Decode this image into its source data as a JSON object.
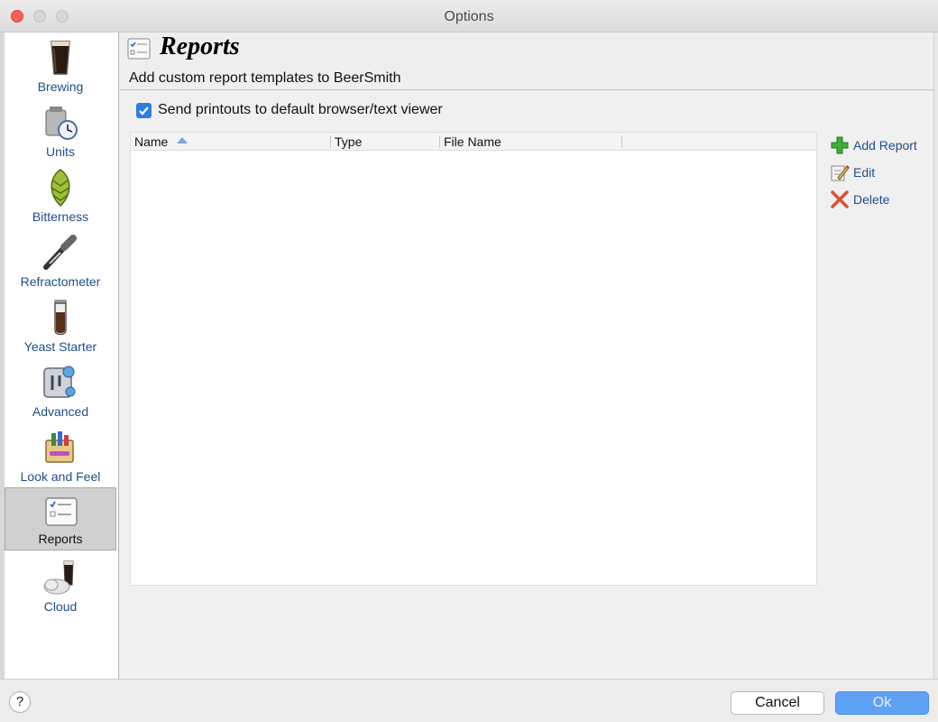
{
  "window": {
    "title": "Options"
  },
  "sidebar": {
    "items": [
      {
        "label": "Brewing",
        "icon": "beer-glass-icon"
      },
      {
        "label": "Units",
        "icon": "units-clock-icon"
      },
      {
        "label": "Bitterness",
        "icon": "hop-cone-icon"
      },
      {
        "label": "Refractometer",
        "icon": "refractometer-icon"
      },
      {
        "label": "Yeast Starter",
        "icon": "test-tube-icon"
      },
      {
        "label": "Advanced",
        "icon": "advanced-gear-icon"
      },
      {
        "label": "Look and Feel",
        "icon": "paint-box-icon"
      },
      {
        "label": "Reports",
        "icon": "report-checklist-icon",
        "selected": true
      },
      {
        "label": "Cloud",
        "icon": "cloud-beer-icon"
      }
    ]
  },
  "header": {
    "title": "Reports",
    "description": "Add custom report templates to BeerSmith"
  },
  "options": {
    "send_printouts_label": "Send printouts to default browser/text viewer",
    "send_printouts_checked": true
  },
  "table": {
    "columns": [
      "Name",
      "Type",
      "File Name"
    ],
    "sort_column": "Name",
    "sort_direction": "ascending",
    "rows": []
  },
  "actions": {
    "add_label": "Add Report",
    "edit_label": "Edit",
    "delete_label": "Delete"
  },
  "footer": {
    "help_label": "?",
    "cancel_label": "Cancel",
    "ok_label": "Ok"
  },
  "colors": {
    "accent": "#2f7de1",
    "nav_label": "#1f4e8c",
    "ok_button": "#5ea2f5",
    "close_button": "#fd5f57"
  }
}
